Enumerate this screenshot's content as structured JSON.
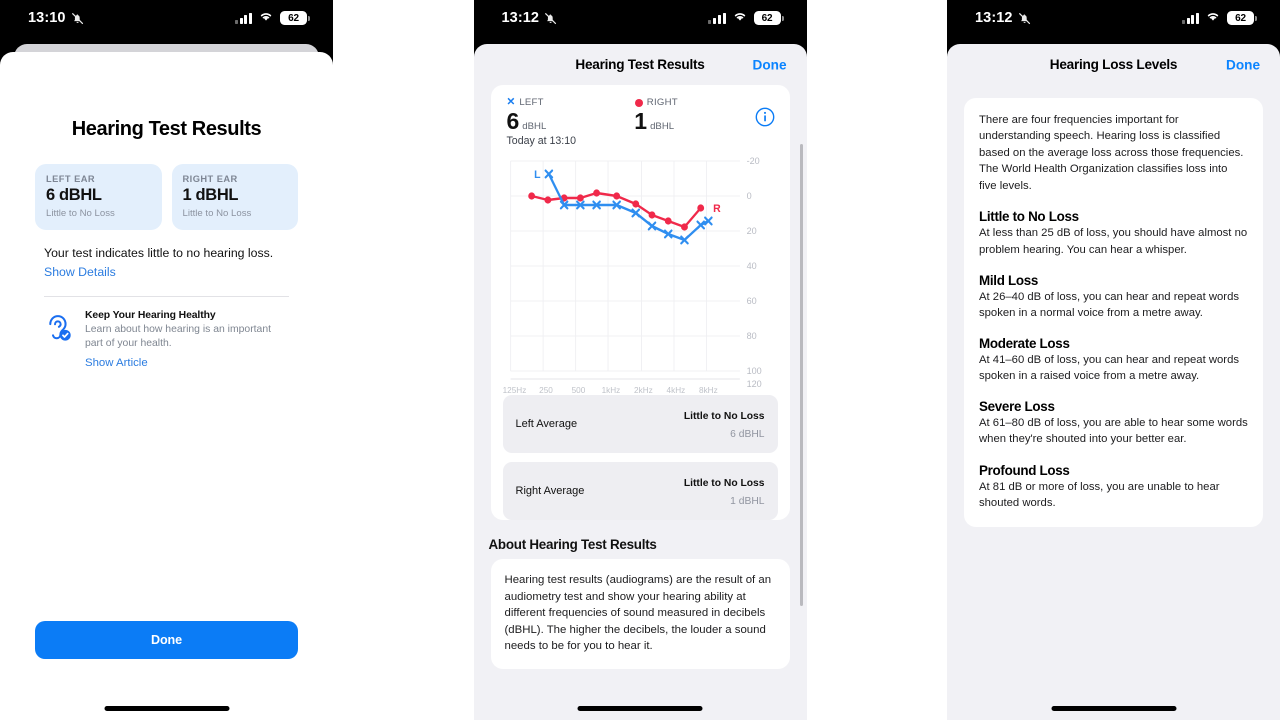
{
  "status_bar": {
    "time_left_phone": "13:10",
    "time_mid_phone": "13:12",
    "time_right_phone": "13:12",
    "battery": "62",
    "mute_icon": "bell-slash-icon",
    "signal_icon": "cellular-signal-icon",
    "wifi_icon": "wifi-icon"
  },
  "panel1": {
    "title": "Hearing Test Results",
    "left_card": {
      "label": "LEFT EAR",
      "value": "6 dBHL",
      "status": "Little to No Loss"
    },
    "right_card": {
      "label": "RIGHT EAR",
      "value": "1 dBHL",
      "status": "Little to No Loss"
    },
    "message": "Your test indicates little to no hearing loss.",
    "details_link": "Show Details",
    "article": {
      "icon": "ear-check-icon",
      "title": "Keep Your Hearing Healthy",
      "body": "Learn about how hearing is an important part of your health.",
      "link": "Show Article"
    },
    "done_button": "Done"
  },
  "panel2": {
    "nav_title": "Hearing Test Results",
    "done_button": "Done",
    "legend": {
      "left_marker": "✕",
      "left_label": "LEFT",
      "right_marker": "●",
      "right_label": "RIGHT"
    },
    "left_value": "6",
    "left_unit": "dBHL",
    "right_value": "1",
    "right_unit": "dBHL",
    "timestamp": "Today at 13:10",
    "info_icon": "info-circle-icon",
    "averages": [
      {
        "name": "Left Average",
        "status": "Little to No Loss",
        "value": "6 dBHL"
      },
      {
        "name": "Right Average",
        "status": "Little to No Loss",
        "value": "1 dBHL"
      }
    ],
    "about_heading": "About Hearing Test Results",
    "about_body": "Hearing test results (audiograms) are the result of an audiometry test and show your hearing ability at different frequencies of sound measured in decibels (dBHL). The higher the decibels, the louder a sound needs to be for you to hear it."
  },
  "panel3": {
    "nav_title": "Hearing Loss Levels",
    "done_button": "Done",
    "intro": "There are four frequencies important for understanding speech. Hearing loss is classified based on the average loss across those frequencies. The World Health Organization classifies loss into five levels.",
    "levels": [
      {
        "title": "Little to No Loss",
        "body": "At less than 25 dB of loss, you should have almost no problem hearing. You can hear a whisper."
      },
      {
        "title": "Mild Loss",
        "body": "At 26–40 dB of loss, you can hear and repeat words spoken in a normal voice from a metre away."
      },
      {
        "title": "Moderate Loss",
        "body": "At 41–60 dB of loss, you can hear and repeat words spoken in a raised voice from a metre away."
      },
      {
        "title": "Severe Loss",
        "body": "At 61–80 dB of loss, you are able to hear some words when they're shouted into your better ear."
      },
      {
        "title": "Profound Loss",
        "body": "At 81 dB or more of loss, you are unable to hear shouted words."
      }
    ]
  },
  "chart_data": {
    "type": "line",
    "title": "Audiogram",
    "xlabel": "",
    "ylabel": "dBHL",
    "x": [
      "125Hz",
      "250",
      "500",
      "1kHz",
      "2kHz",
      "4kHz",
      "8kHz"
    ],
    "tick_labels_x": [
      "125Hz",
      "250",
      "500",
      "1kHz",
      "2kHz",
      "4kHz",
      "8kHz"
    ],
    "tick_labels_y": [
      "-20",
      "0",
      "20",
      "40",
      "60",
      "80",
      "100",
      "120"
    ],
    "ylim": [
      -20,
      120
    ],
    "y_inverted": true,
    "grid": true,
    "legend": [
      "L",
      "R"
    ],
    "annotations": [
      {
        "text": "L",
        "x": "250",
        "position": "left-of-first-point",
        "color": "#1a7ef0"
      },
      {
        "text": "R",
        "x": "8kHz",
        "position": "right-of-last-point",
        "color": "#f0294a"
      }
    ],
    "series": [
      {
        "name": "L",
        "label": "LEFT",
        "color": "#2f8ef0",
        "marker": "x",
        "x": [
          "250",
          "375",
          "500",
          "750",
          "1kHz",
          "1.5kHz",
          "2kHz",
          "3kHz",
          "4kHz",
          "6kHz",
          "8kHz"
        ],
        "values": [
          -13,
          2,
          2,
          2,
          2,
          9,
          14,
          18,
          23,
          18,
          16
        ]
      },
      {
        "name": "R",
        "label": "RIGHT",
        "color": "#f0294a",
        "marker": "circle",
        "x": [
          "250",
          "375",
          "500",
          "750",
          "1kHz",
          "1.5kHz",
          "2kHz",
          "3kHz",
          "4kHz",
          "6kHz",
          "8kHz"
        ],
        "values": [
          0,
          -2,
          -1,
          -1,
          -4,
          2,
          9,
          11,
          14,
          7,
          7
        ]
      }
    ]
  }
}
